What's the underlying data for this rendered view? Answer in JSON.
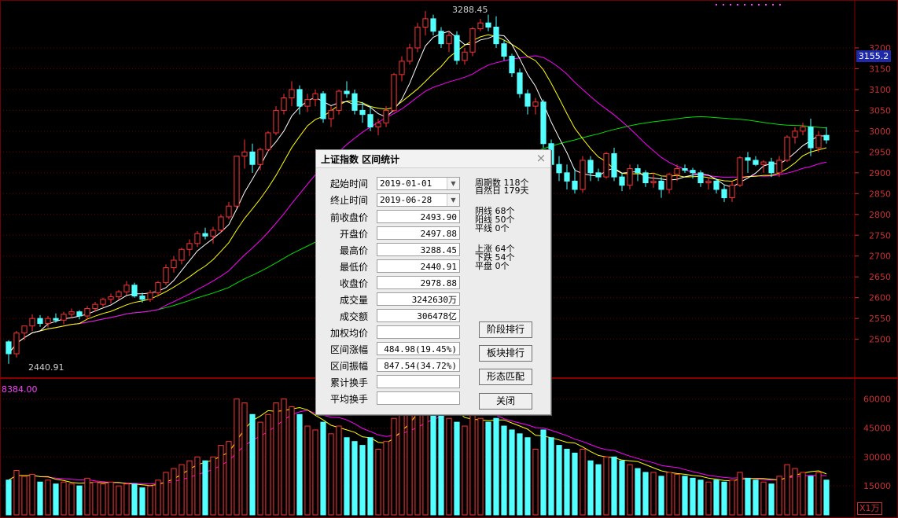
{
  "chart": {
    "high_label": "3288.45",
    "low_label": "2440.91",
    "current_price": "3155.2",
    "volume_peak_label": "8384.00",
    "volume_unit": "X1万",
    "price_axis": [
      "3200",
      "3150",
      "3100",
      "3050",
      "3000",
      "2950",
      "2900",
      "2850",
      "2800",
      "2750",
      "2700",
      "2650",
      "2600",
      "2550",
      "2500"
    ],
    "volume_axis": [
      "60000",
      "45000",
      "30000",
      "15000"
    ],
    "colors": {
      "up": "#ff3232",
      "down": "#54ffff",
      "ma5": "#ffffff",
      "ma10": "#ffff00",
      "ma20": "#ff00ff",
      "ma60": "#00e000",
      "grid": "#6e0000",
      "axis_text": "#c83232"
    }
  },
  "chart_data": {
    "type": "candlestick",
    "y_range": [
      2420,
      3300
    ],
    "volume_range": [
      0,
      68000
    ],
    "candles": [
      [
        2493.9,
        2497.9,
        2440.9,
        2465.3,
        18000
      ],
      [
        2465.3,
        2520.1,
        2456.1,
        2514.9,
        23000
      ],
      [
        2514.9,
        2530,
        2498,
        2532,
        20000
      ],
      [
        2532,
        2560,
        2520,
        2550,
        21000
      ],
      [
        2550,
        2558,
        2530,
        2538,
        17000
      ],
      [
        2538,
        2556,
        2528,
        2550,
        18000
      ],
      [
        2550,
        2562,
        2540,
        2546,
        16000
      ],
      [
        2546,
        2566,
        2536,
        2560,
        17000
      ],
      [
        2560,
        2574,
        2552,
        2566,
        16000
      ],
      [
        2566,
        2570,
        2548,
        2556,
        15000
      ],
      [
        2556,
        2580,
        2548,
        2574,
        19000
      ],
      [
        2574,
        2590,
        2566,
        2584,
        17000
      ],
      [
        2584,
        2600,
        2578,
        2596,
        16000
      ],
      [
        2596,
        2610,
        2586,
        2602,
        17000
      ],
      [
        2602,
        2618,
        2594,
        2614,
        15000
      ],
      [
        2614,
        2640,
        2606,
        2630,
        16000
      ],
      [
        2630,
        2636,
        2600,
        2604,
        16000
      ],
      [
        2604,
        2612,
        2588,
        2596,
        14000
      ],
      [
        2596,
        2618,
        2590,
        2612,
        15000
      ],
      [
        2612,
        2640,
        2606,
        2636,
        18000
      ],
      [
        2636,
        2680,
        2630,
        2672,
        22000
      ],
      [
        2672,
        2700,
        2660,
        2690,
        24000
      ],
      [
        2690,
        2720,
        2680,
        2716,
        26000
      ],
      [
        2716,
        2740,
        2700,
        2730,
        28000
      ],
      [
        2730,
        2760,
        2722,
        2754,
        30000
      ],
      [
        2754,
        2768,
        2740,
        2748,
        28000
      ],
      [
        2748,
        2770,
        2730,
        2762,
        30000
      ],
      [
        2762,
        2800,
        2756,
        2794,
        36000
      ],
      [
        2794,
        2830,
        2788,
        2820,
        38000
      ],
      [
        2820,
        2940,
        2816,
        2940,
        60000
      ],
      [
        2940,
        2980,
        2910,
        2950,
        58000
      ],
      [
        2950,
        2970,
        2900,
        2920,
        52000
      ],
      [
        2920,
        2960,
        2906,
        2956,
        48000
      ],
      [
        2956,
        3000,
        2950,
        2996,
        52000
      ],
      [
        2996,
        3060,
        2990,
        3050,
        58000
      ],
      [
        3050,
        3090,
        3040,
        3080,
        60000
      ],
      [
        3080,
        3120,
        3060,
        3100,
        56000
      ],
      [
        3100,
        3110,
        3040,
        3060,
        52000
      ],
      [
        3060,
        3090,
        3046,
        3076,
        46000
      ],
      [
        3076,
        3100,
        3060,
        3090,
        44000
      ],
      [
        3090,
        3096,
        3020,
        3030,
        48000
      ],
      [
        3030,
        3060,
        3010,
        3050,
        42000
      ],
      [
        3050,
        3100,
        3040,
        3096,
        46000
      ],
      [
        3096,
        3120,
        3080,
        3090,
        40000
      ],
      [
        3090,
        3100,
        3040,
        3050,
        38000
      ],
      [
        3050,
        3070,
        3020,
        3040,
        36000
      ],
      [
        3040,
        3060,
        3000,
        3010,
        40000
      ],
      [
        3010,
        3030,
        2990,
        3020,
        34000
      ],
      [
        3020,
        3060,
        3010,
        3050,
        38000
      ],
      [
        3050,
        3140,
        3046,
        3136,
        50000
      ],
      [
        3136,
        3180,
        3120,
        3168,
        56000
      ],
      [
        3168,
        3210,
        3160,
        3200,
        58000
      ],
      [
        3200,
        3260,
        3190,
        3250,
        62000
      ],
      [
        3250,
        3288.5,
        3230,
        3270,
        64000
      ],
      [
        3270,
        3280,
        3230,
        3240,
        56000
      ],
      [
        3240,
        3250,
        3200,
        3210,
        52000
      ],
      [
        3210,
        3240,
        3190,
        3230,
        50000
      ],
      [
        3230,
        3240,
        3160,
        3170,
        48000
      ],
      [
        3170,
        3200,
        3160,
        3190,
        46000
      ],
      [
        3190,
        3250,
        3180,
        3246,
        52000
      ],
      [
        3246,
        3270,
        3240,
        3260,
        50000
      ],
      [
        3260,
        3280,
        3240,
        3250,
        48000
      ],
      [
        3250,
        3276,
        3200,
        3210,
        50000
      ],
      [
        3210,
        3220,
        3170,
        3180,
        46000
      ],
      [
        3180,
        3186,
        3130,
        3140,
        44000
      ],
      [
        3140,
        3150,
        3080,
        3090,
        42000
      ],
      [
        3090,
        3100,
        3040,
        3060,
        40000
      ],
      [
        3060,
        3080,
        3040,
        3070,
        34000
      ],
      [
        3070,
        3076,
        2960,
        2970,
        44000
      ],
      [
        2970,
        2980,
        2906,
        2920,
        40000
      ],
      [
        2920,
        2940,
        2880,
        2900,
        36000
      ],
      [
        2900,
        2920,
        2860,
        2880,
        34000
      ],
      [
        2880,
        2910,
        2850,
        2860,
        32000
      ],
      [
        2860,
        2940,
        2852,
        2930,
        34000
      ],
      [
        2930,
        2940,
        2880,
        2900,
        28000
      ],
      [
        2900,
        2910,
        2880,
        2890,
        26000
      ],
      [
        2890,
        2950,
        2886,
        2946,
        30000
      ],
      [
        2946,
        2960,
        2880,
        2890,
        30000
      ],
      [
        2890,
        2900,
        2856,
        2870,
        28000
      ],
      [
        2870,
        2920,
        2860,
        2910,
        26000
      ],
      [
        2910,
        2920,
        2880,
        2900,
        24000
      ],
      [
        2900,
        2906,
        2866,
        2876,
        22000
      ],
      [
        2876,
        2900,
        2864,
        2880,
        22000
      ],
      [
        2880,
        2890,
        2840,
        2860,
        20000
      ],
      [
        2860,
        2900,
        2850,
        2896,
        22000
      ],
      [
        2896,
        2920,
        2880,
        2910,
        21000
      ],
      [
        2910,
        2920,
        2900,
        2906,
        20000
      ],
      [
        2906,
        2912,
        2886,
        2900,
        19000
      ],
      [
        2900,
        2906,
        2866,
        2876,
        18000
      ],
      [
        2876,
        2890,
        2860,
        2880,
        17000
      ],
      [
        2880,
        2886,
        2850,
        2860,
        18000
      ],
      [
        2860,
        2870,
        2830,
        2840,
        17000
      ],
      [
        2840,
        2880,
        2830,
        2870,
        18000
      ],
      [
        2870,
        2940,
        2866,
        2936,
        22000
      ],
      [
        2936,
        2950,
        2900,
        2930,
        19000
      ],
      [
        2930,
        2940,
        2916,
        2920,
        18000
      ],
      [
        2920,
        2930,
        2900,
        2926,
        17000
      ],
      [
        2926,
        2936,
        2890,
        2900,
        16000
      ],
      [
        2900,
        2940,
        2890,
        2930,
        20000
      ],
      [
        2930,
        2990,
        2926,
        2986,
        26000
      ],
      [
        2986,
        3010,
        2970,
        3000,
        24000
      ],
      [
        3000,
        3020,
        2990,
        3010,
        22000
      ],
      [
        3010,
        3030,
        2940,
        2960,
        20000
      ],
      [
        2960,
        3000,
        2950,
        2990,
        22000
      ],
      [
        2990,
        3010,
        2970,
        2978.9,
        18000
      ]
    ]
  },
  "dialog": {
    "title": "上证指数 区间统计",
    "close_label": "×",
    "start_label": "起始时间",
    "start_value": "2019-01-01",
    "end_label": "终止时间",
    "end_value": "2019-06-28",
    "rows": [
      {
        "label": "前收盘价",
        "value": "2493.90"
      },
      {
        "label": "开盘价",
        "value": "2497.88"
      },
      {
        "label": "最高价",
        "value": "3288.45"
      },
      {
        "label": "最低价",
        "value": "2440.91"
      },
      {
        "label": "收盘价",
        "value": "2978.88"
      },
      {
        "label": "成交量",
        "value": "3242630万"
      },
      {
        "label": "成交额",
        "value": "306478亿"
      },
      {
        "label": "加权均价",
        "value": ""
      },
      {
        "label": "区间涨幅",
        "value": "484.98(19.45%)"
      },
      {
        "label": "区间振幅",
        "value": "847.54(34.72%)"
      },
      {
        "label": "累计换手",
        "value": ""
      },
      {
        "label": "平均换手",
        "value": ""
      }
    ],
    "stats": {
      "period": "周期数 118个",
      "natural": "自然日 179天",
      "yin": "阴线 68个",
      "yang": "阳线 50个",
      "flat": "平线 0个",
      "rise": "上涨 64个",
      "fall": "下跌 54个",
      "even": "平盘 0个"
    },
    "buttons": {
      "stage_rank": "阶段排行",
      "sector_rank": "板块排行",
      "pattern_match": "形态匹配",
      "close": "关闭"
    }
  }
}
